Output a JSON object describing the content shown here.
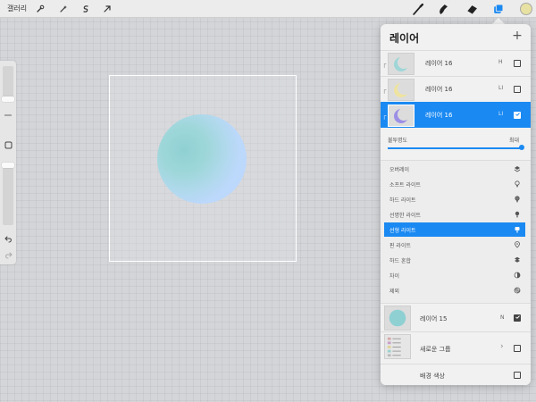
{
  "topbar": {
    "gallery_label": "갤러리",
    "left_tools": [
      {
        "name": "wrench-icon"
      },
      {
        "name": "magic-wand-icon"
      },
      {
        "name": "selection-icon"
      },
      {
        "name": "transform-arrow-icon"
      }
    ],
    "right_tools": [
      {
        "name": "brush-icon"
      },
      {
        "name": "smudge-icon"
      },
      {
        "name": "eraser-icon"
      },
      {
        "name": "layers-icon"
      }
    ],
    "color_well": "#e7e1a3",
    "accent": "#1a89f2"
  },
  "sidebar": {
    "tools": [
      {
        "name": "modify-square-icon"
      },
      {
        "name": "undo-icon"
      },
      {
        "name": "redo-icon"
      }
    ]
  },
  "canvas": {
    "circle_colors": [
      "#8fd0d3",
      "#bad7fd"
    ]
  },
  "layers_panel": {
    "title": "레이어",
    "add_label": "+",
    "layers": [
      {
        "name": "레이어 16",
        "blend": "H",
        "checked": false,
        "thumb": "teal-crescent",
        "active": false
      },
      {
        "name": "레이어 16",
        "blend": "LI",
        "checked": false,
        "thumb": "yellow-crescent",
        "active": false
      },
      {
        "name": "레이어 16",
        "blend": "LI",
        "checked": true,
        "thumb": "purple-crescent",
        "active": true
      }
    ],
    "opacity": {
      "label": "불투명도",
      "value": "최대",
      "level": 1.0
    },
    "blend_modes": [
      {
        "label": "오버레이",
        "icon": "overlay-icon",
        "active": false
      },
      {
        "label": "소프트 라이트",
        "icon": "soft-light-icon",
        "active": false
      },
      {
        "label": "하드 라이트",
        "icon": "hard-light-icon",
        "active": false
      },
      {
        "label": "선명한 라이트",
        "icon": "vivid-light-icon",
        "active": false
      },
      {
        "label": "선형 라이트",
        "icon": "linear-light-icon",
        "active": true
      },
      {
        "label": "핀 라이트",
        "icon": "pin-light-icon",
        "active": false
      },
      {
        "label": "하드 혼합",
        "icon": "hard-mix-icon",
        "active": false
      },
      {
        "label": "차이",
        "icon": "difference-icon",
        "active": false
      },
      {
        "label": "제외",
        "icon": "exclusion-icon",
        "active": false
      }
    ],
    "lower_layers": [
      {
        "name": "레이어 15",
        "blend": "N",
        "checked": true
      },
      {
        "name": "새로운 그룹",
        "checked": false
      },
      {
        "name": "배경 색상",
        "checked": false
      }
    ]
  }
}
